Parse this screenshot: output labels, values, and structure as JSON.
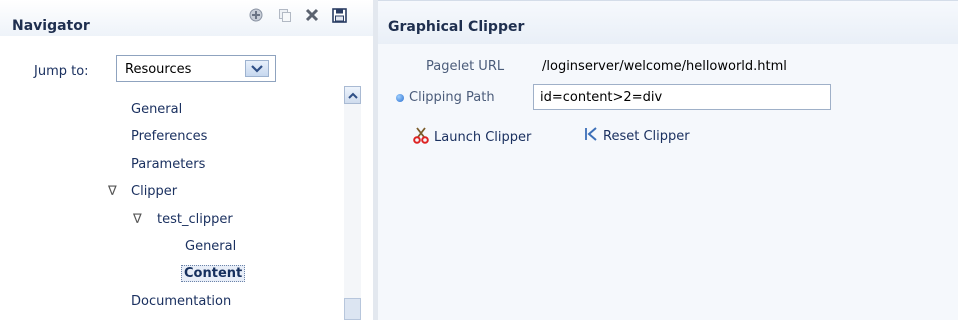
{
  "navigator": {
    "title": "Navigator",
    "toolbar": [
      "add-icon",
      "copy-icon",
      "delete-icon",
      "save-icon"
    ],
    "jump_to_label": "Jump to:",
    "jump_to_value": "Resources",
    "tree": [
      {
        "label": "General",
        "level": 0
      },
      {
        "label": "Preferences",
        "level": 0
      },
      {
        "label": "Parameters",
        "level": 0
      },
      {
        "label": "Clipper",
        "level": 0,
        "expanded": true
      },
      {
        "label": "test_clipper",
        "level": 1,
        "expanded": true
      },
      {
        "label": "General",
        "level": 2
      },
      {
        "label": "Content",
        "level": 2,
        "selected": true
      },
      {
        "label": "Documentation",
        "level": 0
      }
    ]
  },
  "main": {
    "title": "Graphical Clipper",
    "pagelet_url_label": "Pagelet URL",
    "pagelet_url_value": "/loginserver/welcome/helloworld.html",
    "clipping_path_label": "Clipping Path",
    "clipping_path_value": "id=content>2=div",
    "launch_clipper_label": "Launch Clipper",
    "reset_clipper_label": "Reset Clipper"
  },
  "colors": {
    "header_text": "#1f2f4f",
    "link_text": "#1b3160",
    "required_dot": "#2a6fd0"
  }
}
